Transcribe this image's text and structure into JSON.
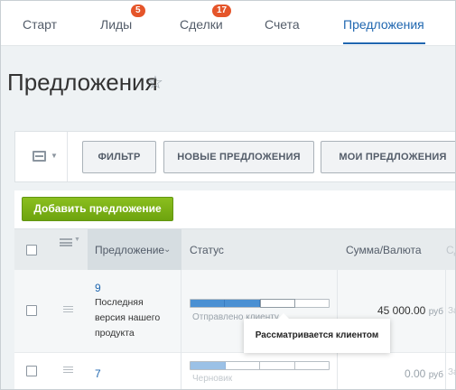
{
  "nav": {
    "tabs": [
      {
        "label": "Старт",
        "badge": null
      },
      {
        "label": "Лиды",
        "badge": "5"
      },
      {
        "label": "Сделки",
        "badge": "17"
      },
      {
        "label": "Счета",
        "badge": null
      },
      {
        "label": "Предложения",
        "badge": null,
        "active": true
      }
    ]
  },
  "page": {
    "title": "Предложения",
    "star_icon": "star-outline-icon"
  },
  "filters": {
    "view_icon": "list-view-icon",
    "buttons": [
      "ФИЛЬТР",
      "НОВЫЕ ПРЕДЛОЖЕНИЯ",
      "МОИ ПРЕДЛОЖЕНИЯ"
    ]
  },
  "grid": {
    "add_button": "Добавить предложение",
    "columns": [
      "Предложение",
      "Статус",
      "Сумма/Валюта",
      "Сд"
    ],
    "rows": [
      {
        "id": "9",
        "title_lines": [
          "Последняя",
          "версия нашего",
          "продукта"
        ],
        "status_progress": 0.5,
        "status_label": "Отправлено клиенту",
        "amount": "45 000.00",
        "currency": "руб",
        "extra": "За"
      },
      {
        "id": "7",
        "title_lines": [],
        "status_progress": 0.2,
        "status_label": "Черновик",
        "amount": "0.00",
        "currency": "руб",
        "extra": "За"
      }
    ]
  },
  "tooltip": {
    "text": "Рассматривается клиентом"
  },
  "colors": {
    "accent": "#2067b0",
    "badge": "#e5552a",
    "add_button": "#7cb518",
    "progress": "#4a90d3"
  }
}
